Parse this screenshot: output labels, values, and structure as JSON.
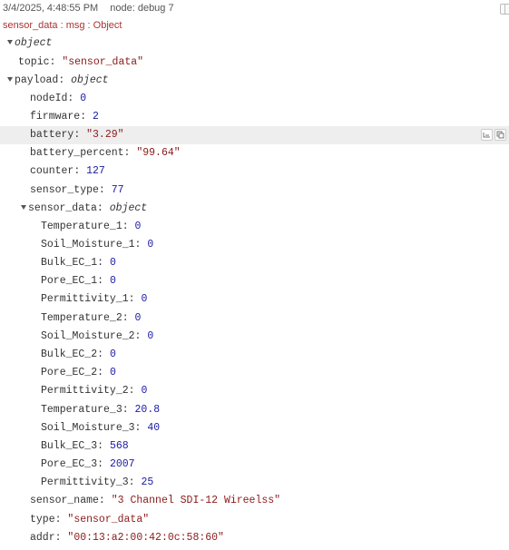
{
  "header": {
    "timestamp": "3/4/2025, 4:48:55 PM",
    "node": "node: debug 7"
  },
  "msg_info": "sensor_data : msg : Object",
  "tree": {
    "root_type": "object",
    "topic": {
      "key": "topic",
      "value": "\"sensor_data\""
    },
    "payload_key": "payload",
    "payload_type": "object",
    "payload": {
      "nodeId": {
        "key": "nodeId",
        "value": "0"
      },
      "firmware": {
        "key": "firmware",
        "value": "2"
      },
      "battery": {
        "key": "battery",
        "value": "\"3.29\""
      },
      "battery_percent": {
        "key": "battery_percent",
        "value": "\"99.64\""
      },
      "counter": {
        "key": "counter",
        "value": "127"
      },
      "sensor_type": {
        "key": "sensor_type",
        "value": "77"
      },
      "sensor_data_key": "sensor_data",
      "sensor_data_type": "object",
      "sensor_data": [
        {
          "key": "Temperature_1",
          "value": "0"
        },
        {
          "key": "Soil_Moisture_1",
          "value": "0"
        },
        {
          "key": "Bulk_EC_1",
          "value": "0"
        },
        {
          "key": "Pore_EC_1",
          "value": "0"
        },
        {
          "key": "Permittivity_1",
          "value": "0"
        },
        {
          "key": "Temperature_2",
          "value": "0"
        },
        {
          "key": "Soil_Moisture_2",
          "value": "0"
        },
        {
          "key": "Bulk_EC_2",
          "value": "0"
        },
        {
          "key": "Pore_EC_2",
          "value": "0"
        },
        {
          "key": "Permittivity_2",
          "value": "0"
        },
        {
          "key": "Temperature_3",
          "value": "20.8"
        },
        {
          "key": "Soil_Moisture_3",
          "value": "40"
        },
        {
          "key": "Bulk_EC_3",
          "value": "568"
        },
        {
          "key": "Pore_EC_3",
          "value": "2007"
        },
        {
          "key": "Permittivity_3",
          "value": "25"
        }
      ],
      "sensor_name": {
        "key": "sensor_name",
        "value": "\"3 Channel SDI-12 Wireelss\""
      },
      "type": {
        "key": "type",
        "value": "\"sensor_data\""
      },
      "addr": {
        "key": "addr",
        "value": "\"00:13:a2:00:42:0c:58:60\""
      }
    }
  },
  "icons": {
    "header_actions": [
      "open-in-window-icon",
      "copy-icon"
    ],
    "row_actions": [
      "copy-path-icon",
      "copy-value-icon"
    ]
  },
  "colors": {
    "string": "#8b1a1a",
    "number": "#1a1aa6",
    "key": "#333333",
    "msg_info": "#aa3333",
    "highlight": "#eeeeee"
  }
}
